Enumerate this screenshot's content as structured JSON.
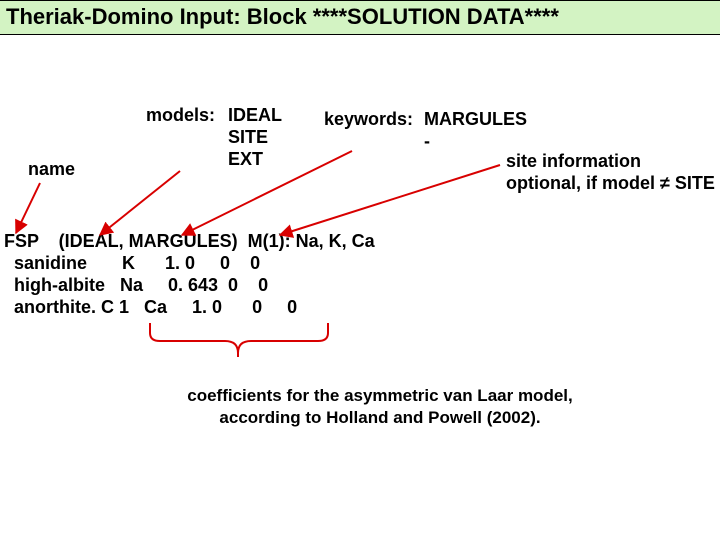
{
  "title": "Theriak-Domino Input: Block ****SOLUTION DATA****",
  "labels": {
    "models_hdr": "models:",
    "model1": "IDEAL",
    "model2": "SITE",
    "model3": "EXT",
    "keywords_hdr": "keywords:",
    "keyword1": "MARGULES",
    "keyword2": "-",
    "name": "name",
    "siteinfo1": "site information",
    "siteinfo2": "optional, if model ≠ SITE"
  },
  "block": {
    "l1": "FSP    (IDEAL, MARGULES)  M(1): Na, K, Ca",
    "l2": "  sanidine       K      1. 0     0    0",
    "l3": "  high-albite   Na     0. 643  0    0",
    "l4": "  anorthite. C 1   Ca     1. 0      0     0"
  },
  "caption": {
    "l1": "coefficients for the asymmetric van Laar model,",
    "l2": "according to Holland and Powell (2002)."
  }
}
